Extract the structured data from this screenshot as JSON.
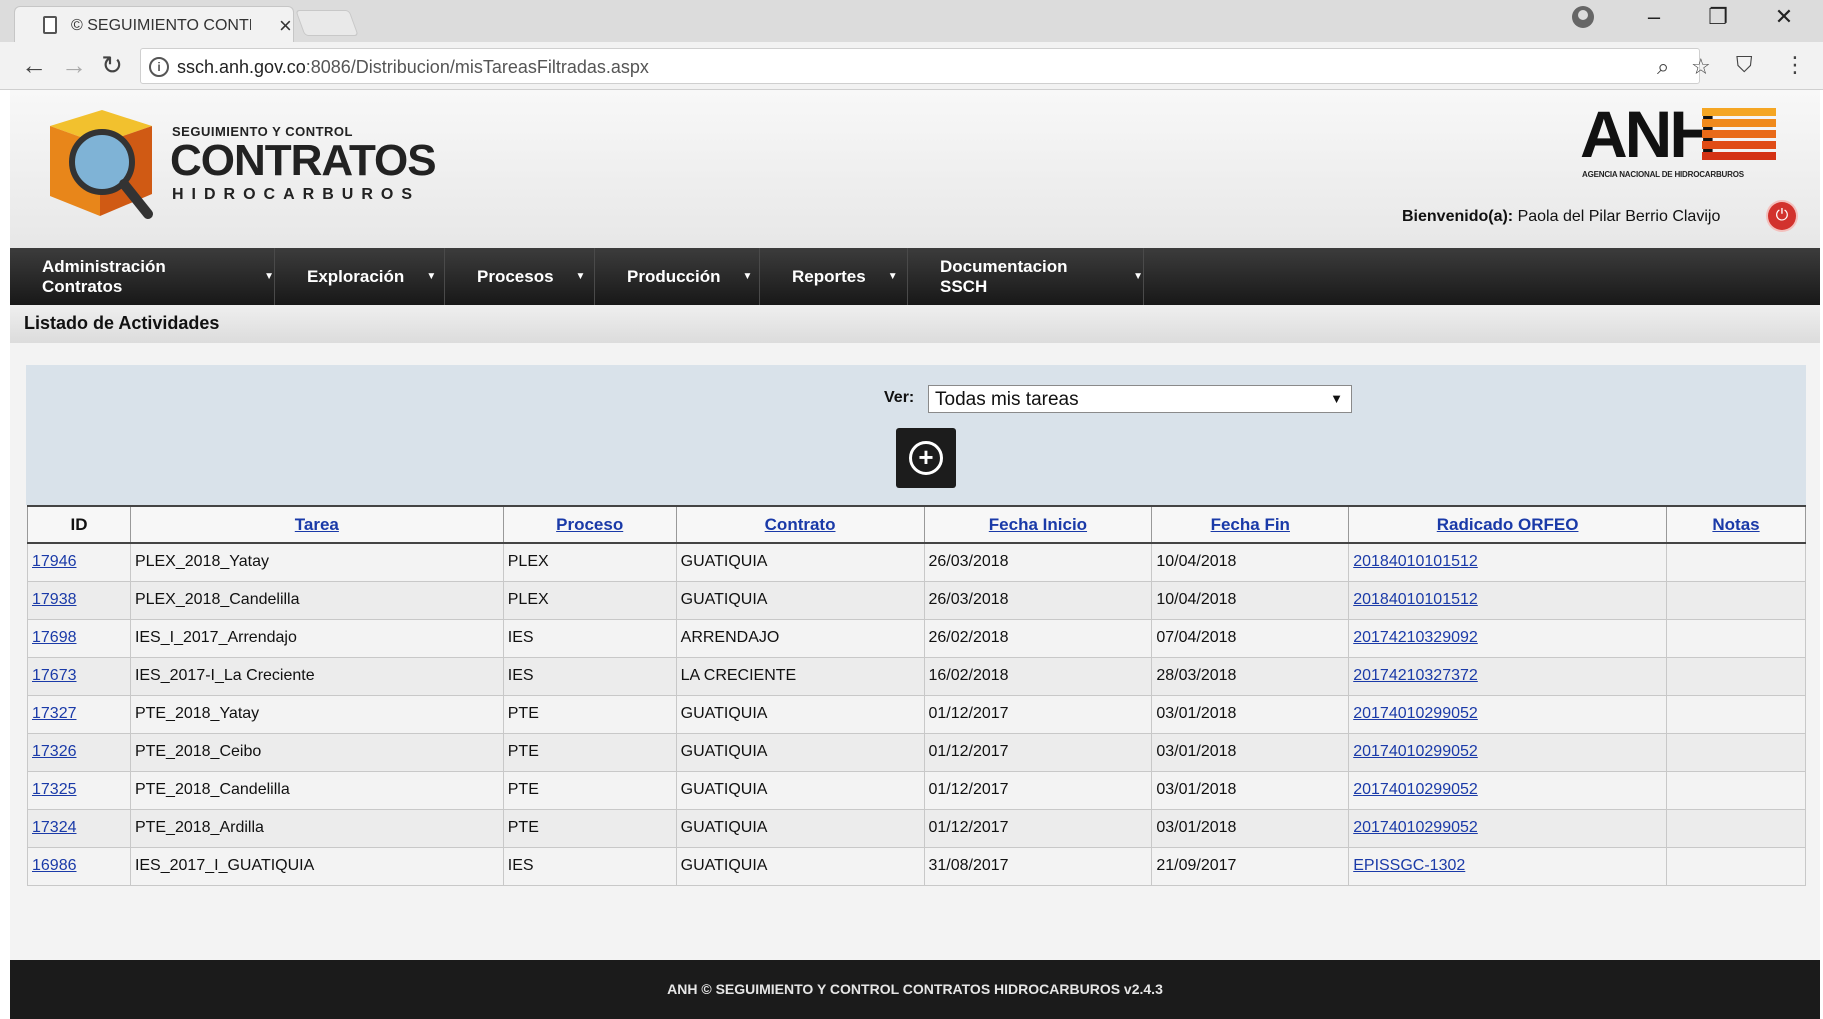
{
  "browser": {
    "tab_title": "© SEGUIMIENTO CONTR",
    "url_host": "ssch.anh.gov.co",
    "url_path": ":8086/Distribucion/misTareasFiltradas.aspx"
  },
  "header": {
    "logo_small": "SEGUIMIENTO Y CONTROL",
    "logo_big": "CONTRATOS",
    "logo_sub": "HIDROCARBUROS",
    "anh_text": "ANH",
    "anh_caption": "AGENCIA NACIONAL DE HIDROCARBUROS",
    "welcome_label": "Bienvenido(a):",
    "welcome_user": "Paola del Pilar Berrio Clavijo"
  },
  "nav": {
    "items": [
      {
        "label": "Administración Contratos"
      },
      {
        "label": "Exploración"
      },
      {
        "label": "Procesos"
      },
      {
        "label": "Producción"
      },
      {
        "label": "Reportes"
      },
      {
        "label": "Documentacion SSCH"
      }
    ]
  },
  "page": {
    "title": "Listado de Actividades",
    "filter_label": "Ver:",
    "filter_value": "Todas mis tareas"
  },
  "table": {
    "headers": {
      "id": "ID",
      "tarea": "Tarea",
      "proceso": "Proceso",
      "contrato": "Contrato",
      "fecha_inicio": "Fecha Inicio",
      "fecha_fin": "Fecha Fin",
      "radicado": "Radicado ORFEO",
      "notas": "Notas"
    },
    "rows": [
      {
        "id": "17946",
        "tarea": "PLEX_2018_Yatay",
        "proceso": "PLEX",
        "contrato": "GUATIQUIA",
        "inicio": "26/03/2018",
        "fin": "10/04/2018",
        "radicado": "20184010101512",
        "notas": ""
      },
      {
        "id": "17938",
        "tarea": "PLEX_2018_Candelilla",
        "proceso": "PLEX",
        "contrato": "GUATIQUIA",
        "inicio": "26/03/2018",
        "fin": "10/04/2018",
        "radicado": "20184010101512",
        "notas": ""
      },
      {
        "id": "17698",
        "tarea": "IES_I_2017_Arrendajo",
        "proceso": "IES",
        "contrato": "ARRENDAJO",
        "inicio": "26/02/2018",
        "fin": "07/04/2018",
        "radicado": "20174210329092",
        "notas": ""
      },
      {
        "id": "17673",
        "tarea": "IES_2017-I_La Creciente",
        "proceso": "IES",
        "contrato": "LA CRECIENTE",
        "inicio": "16/02/2018",
        "fin": "28/03/2018",
        "radicado": "20174210327372",
        "notas": ""
      },
      {
        "id": "17327",
        "tarea": "PTE_2018_Yatay",
        "proceso": "PTE",
        "contrato": "GUATIQUIA",
        "inicio": "01/12/2017",
        "fin": "03/01/2018",
        "radicado": "20174010299052",
        "notas": ""
      },
      {
        "id": "17326",
        "tarea": "PTE_2018_Ceibo",
        "proceso": "PTE",
        "contrato": "GUATIQUIA",
        "inicio": "01/12/2017",
        "fin": "03/01/2018",
        "radicado": "20174010299052",
        "notas": ""
      },
      {
        "id": "17325",
        "tarea": "PTE_2018_Candelilla",
        "proceso": "PTE",
        "contrato": "GUATIQUIA",
        "inicio": "01/12/2017",
        "fin": "03/01/2018",
        "radicado": "20174010299052",
        "notas": ""
      },
      {
        "id": "17324",
        "tarea": "PTE_2018_Ardilla",
        "proceso": "PTE",
        "contrato": "GUATIQUIA",
        "inicio": "01/12/2017",
        "fin": "03/01/2018",
        "radicado": "20174010299052",
        "notas": ""
      },
      {
        "id": "16986",
        "tarea": "IES_2017_I_GUATIQUIA",
        "proceso": "IES",
        "contrato": "GUATIQUIA",
        "inicio": "31/08/2017",
        "fin": "21/09/2017",
        "radicado": "EPISSGC-1302",
        "notas": ""
      }
    ]
  },
  "footer": {
    "text": "ANH © SEGUIMIENTO Y CONTROL CONTRATOS HIDROCARBUROS v2.4.3"
  },
  "colors": {
    "navbar": "#222222",
    "link": "#1a3aa8",
    "power": "#d2322d",
    "filter_panel": "#d9e2ea"
  }
}
